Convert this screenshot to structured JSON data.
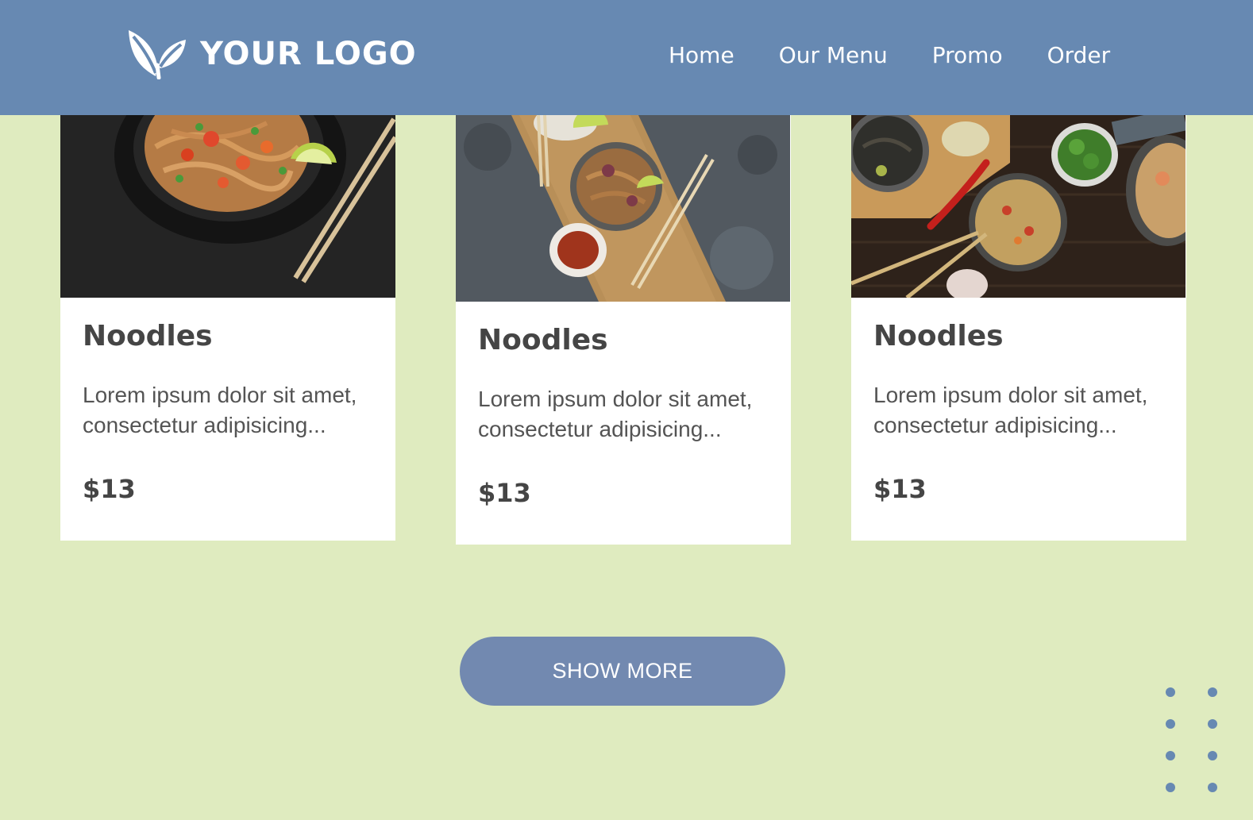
{
  "header": {
    "logo_text": "YOUR LOGO",
    "nav": [
      "Home",
      "Our Menu",
      "Promo",
      "Order"
    ]
  },
  "cards": [
    {
      "title": "Noodles",
      "description_line1": "Lorem ipsum dolor sit amet,",
      "description_line2": "consectetur adipisicing...",
      "price": "$13"
    },
    {
      "title": "Noodles",
      "description_line1": "Lorem ipsum dolor sit amet,",
      "description_line2": "consectetur adipisicing...",
      "price": "$13"
    },
    {
      "title": "Noodles",
      "description_line1": "Lorem ipsum dolor sit amet,",
      "description_line2": "consectetur adipisicing...",
      "price": "$13"
    }
  ],
  "show_more_label": "SHOW MORE",
  "colors": {
    "header": "#6789b2",
    "background": "#dfebbf",
    "button": "#7289b0",
    "card": "#ffffff",
    "text_dark": "#454545"
  }
}
